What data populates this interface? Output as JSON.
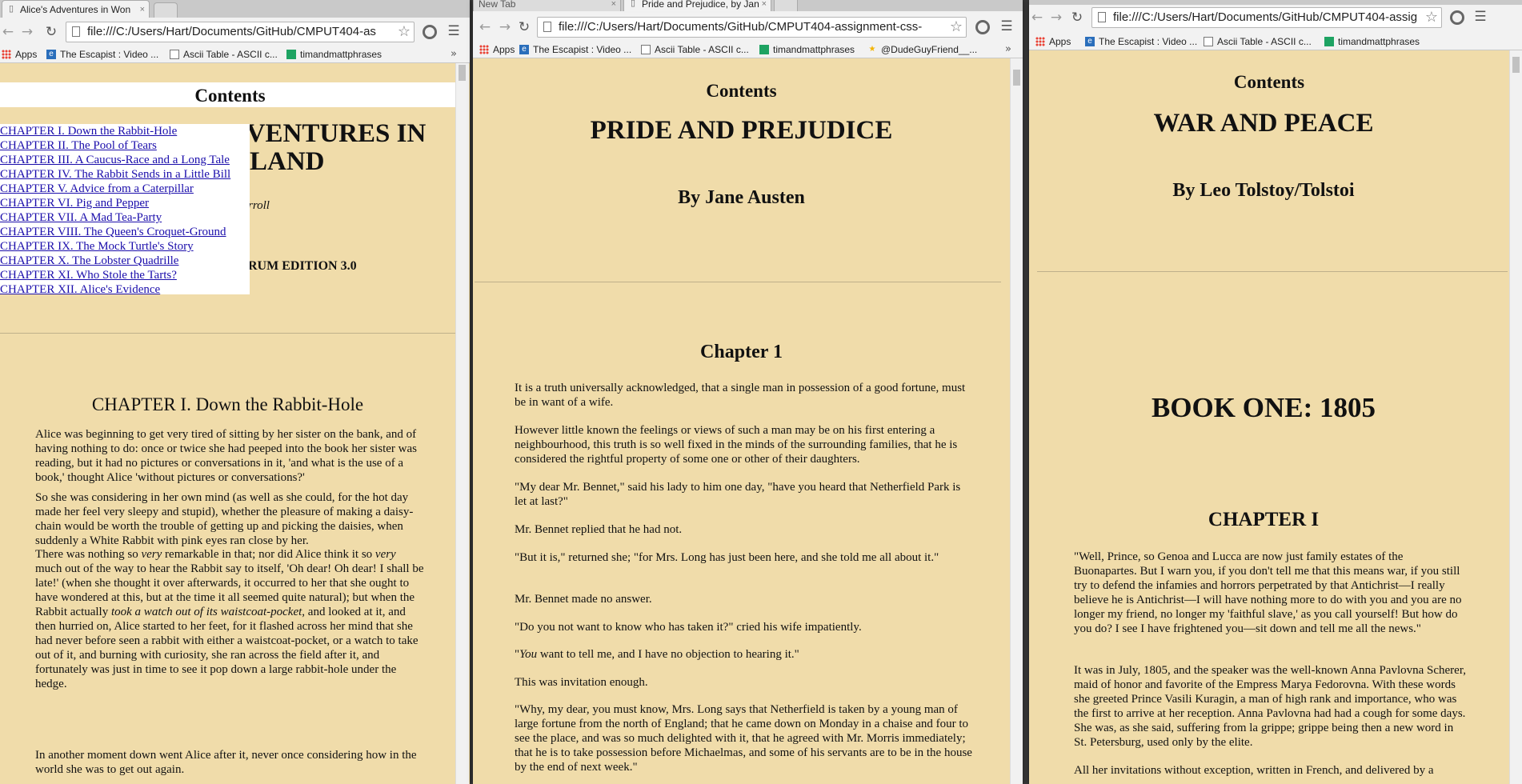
{
  "bookmarks": {
    "apps": "Apps",
    "escapist": "The Escapist : Video ...",
    "ascii": "Ascii Table - ASCII c...",
    "timand": "timandmattphrases",
    "dude": "@DudeGuyFriend__...",
    "more": "»"
  },
  "icons": {
    "back": "←",
    "forward": "→",
    "reload": "↻",
    "menu": "☰",
    "star": "☆",
    "close": "×"
  },
  "win1": {
    "tab_title": "Alice's Adventures in Won",
    "url": "file:///C:/Users/Hart/Documents/GitHub/CMPUT404-as",
    "toc_heading": "Contents",
    "title_line1": "ADVENTURES IN",
    "title_line2": "LAND",
    "author_fragment": "rroll",
    "edition_fragment": "RUM EDITION 3.0",
    "toc": [
      "CHAPTER I. Down the Rabbit-Hole",
      "CHAPTER II. The Pool of Tears",
      "CHAPTER III. A Caucus-Race and a Long Tale",
      "CHAPTER IV. The Rabbit Sends in a Little Bill",
      "CHAPTER V. Advice from a Caterpillar",
      "CHAPTER VI. Pig and Pepper",
      "CHAPTER VII. A Mad Tea-Party",
      "CHAPTER VIII. The Queen's Croquet-Ground",
      "CHAPTER IX. The Mock Turtle's Story",
      "CHAPTER X. The Lobster Quadrille",
      "CHAPTER XI. Who Stole the Tarts?",
      "CHAPTER XII. Alice's Evidence"
    ],
    "chapter_heading": "CHAPTER I. Down the Rabbit-Hole",
    "p1": "Alice was beginning to get very tired of sitting by her sister on the bank, and of having nothing to do: once or twice she had peeped into the book her sister was reading, but it had no pictures or conversations in it, 'and what is the use of a book,' thought Alice 'without pictures or conversations?'",
    "p2": "So she was considering in her own mind (as well as she could, for the hot day made her feel very sleepy and stupid), whether the pleasure of making a daisy-chain would be worth the trouble of getting up and picking the daisies, when suddenly a White Rabbit with pink eyes ran close by her.",
    "p3a": "There was nothing so ",
    "p3b": "very",
    "p3c": " remarkable in that; nor did Alice think it so ",
    "p3d": "very",
    "p3e": " much out of the way to hear the Rabbit say to itself, 'Oh dear! Oh dear! I shall be late!' (when she thought it over afterwards, it occurred to her that she ought to have wondered at this, but at the time it all seemed quite natural); but when the Rabbit actually ",
    "p3f": "took a watch out of its waistcoat-pocket",
    "p3g": ", and looked at it, and then hurried on, Alice started to her feet, for it flashed across her mind that she had never before seen a rabbit with either a waistcoat-pocket, or a watch to take out of it, and burning with curiosity, she ran across the field after it, and fortunately was just in time to see it pop down a large rabbit-hole under the hedge.",
    "p4": "In another moment down went Alice after it, never once considering how in the world she was to get out again."
  },
  "win2": {
    "tab_newtab": "New Tab",
    "tab_title": "Pride and Prejudice, by Jan",
    "url": "file:///C:/Users/Hart/Documents/GitHub/CMPUT404-assignment-css-",
    "toc_heading": "Contents",
    "title": "PRIDE AND PREJUDICE",
    "author": "By Jane Austen",
    "chapter_heading": "Chapter 1",
    "p1": "It is a truth universally acknowledged, that a single man in possession of a good fortune, must be in want of a wife.",
    "p2": "However little known the feelings or views of such a man may be on his first entering a neighbourhood, this truth is so well fixed in the minds of the surrounding families, that he is considered the rightful property of some one or other of their daughters.",
    "p3": "\"My dear Mr. Bennet,\" said his lady to him one day, \"have you heard that Netherfield Park is let at last?\"",
    "p4": "Mr. Bennet replied that he had not.",
    "p5": "\"But it is,\" returned she; \"for Mrs. Long has just been here, and she told me all about it.\"",
    "p6": "Mr. Bennet made no answer.",
    "p7": "\"Do you not want to know who has taken it?\" cried his wife impatiently.",
    "p8a": "\"",
    "p8b": "You",
    "p8c": " want to tell me, and I have no objection to hearing it.\"",
    "p9": "This was invitation enough.",
    "p10": "\"Why, my dear, you must know, Mrs. Long says that Netherfield is taken by a young man of large fortune from the north of England; that he came down on Monday in a chaise and four to see the place, and was so much delighted with it, that he agreed with Mr. Morris immediately; that he is to take possession before Michaelmas, and some of his servants are to be in the house by the end of next week.\""
  },
  "win3": {
    "url": "file:///C:/Users/Hart/Documents/GitHub/CMPUT404-assig",
    "toc_heading": "Contents",
    "title": "WAR AND PEACE",
    "author": "By Leo Tolstoy/Tolstoi",
    "book_heading": "BOOK ONE: 1805",
    "chapter_heading": "CHAPTER I",
    "p1": "\"Well, Prince, so Genoa and Lucca are now just family estates of the Buonapartes. But I warn you, if you don't tell me that this means war, if you still try to defend the infamies and horrors perpetrated by that Antichrist—I really believe he is Antichrist—I will have nothing more to do with you and you are no longer my friend, no longer my 'faithful slave,' as you call yourself! But how do you do? I see I have frightened you—sit down and tell me all the news.\"",
    "p2": "It was in July, 1805, and the speaker was the well-known Anna Pavlovna Scherer, maid of honor and favorite of the Empress Marya Fedorovna. With these words she greeted Prince Vasili Kuragin, a man of high rank and importance, who was the first to arrive at her reception. Anna Pavlovna had had a cough for some days. She was, as she said, suffering from la grippe; grippe being then a new word in St. Petersburg, used only by the elite.",
    "p3": "All her invitations without exception, written in French, and delivered by a"
  }
}
